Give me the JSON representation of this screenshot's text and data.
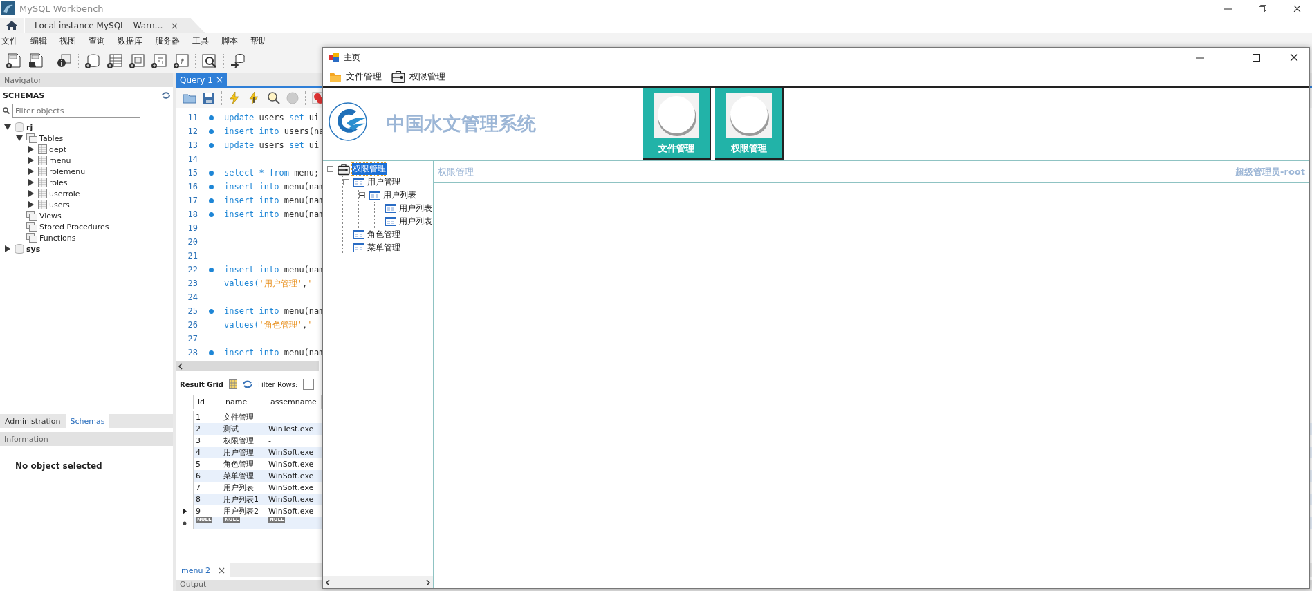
{
  "app": {
    "title": "MySQL Workbench"
  },
  "connection_tabs": [
    {
      "label": "Local instance MySQL - Warn…",
      "selected": true
    }
  ],
  "menu": [
    "文件",
    "编辑",
    "视图",
    "查询",
    "数据库",
    "服务器",
    "工具",
    "脚本",
    "帮助"
  ],
  "navigator": {
    "title": "Navigator",
    "schemas_label": "SCHEMAS",
    "filter_placeholder": "Filter objects",
    "tree": [
      {
        "label": "rj",
        "kind": "schema",
        "expanded": true,
        "children": [
          {
            "label": "Tables",
            "kind": "folder",
            "expanded": true,
            "children": [
              {
                "label": "dept",
                "kind": "table",
                "expanded": false
              },
              {
                "label": "menu",
                "kind": "table",
                "expanded": false
              },
              {
                "label": "rolemenu",
                "kind": "table",
                "expanded": false
              },
              {
                "label": "roles",
                "kind": "table",
                "expanded": false
              },
              {
                "label": "userrole",
                "kind": "table",
                "expanded": false
              },
              {
                "label": "users",
                "kind": "table",
                "expanded": false
              }
            ]
          },
          {
            "label": "Views",
            "kind": "folder"
          },
          {
            "label": "Stored Procedures",
            "kind": "folder"
          },
          {
            "label": "Functions",
            "kind": "folder"
          }
        ]
      },
      {
        "label": "sys",
        "kind": "schema",
        "expanded": false
      }
    ]
  },
  "bottom_tabs": [
    {
      "label": "Administration",
      "selected": false
    },
    {
      "label": "Schemas",
      "selected": true
    }
  ],
  "information": {
    "title": "Information",
    "text": "No object selected"
  },
  "query_tabs": [
    {
      "label": "Query 1",
      "selected": true
    }
  ],
  "editor": {
    "lines": [
      {
        "number": "11",
        "marker": true,
        "code": [
          {
            "t": "update",
            "kind": "keyword"
          },
          {
            "t": " users ",
            "kind": "plain"
          },
          {
            "t": "set",
            "kind": "keyword"
          },
          {
            "t": " ui",
            "kind": "plain"
          }
        ]
      },
      {
        "number": "12",
        "marker": true,
        "code": [
          {
            "t": "insert into",
            "kind": "keyword"
          },
          {
            "t": " users(na",
            "kind": "plain"
          }
        ]
      },
      {
        "number": "13",
        "marker": true,
        "code": [
          {
            "t": "update",
            "kind": "keyword"
          },
          {
            "t": " users ",
            "kind": "plain"
          },
          {
            "t": "set",
            "kind": "keyword"
          },
          {
            "t": " ui",
            "kind": "plain"
          }
        ]
      },
      {
        "number": "14",
        "marker": false
      },
      {
        "number": "15",
        "marker": true,
        "code": [
          {
            "t": "select * from",
            "kind": "keyword"
          },
          {
            "t": " menu;",
            "kind": "plain"
          }
        ]
      },
      {
        "number": "16",
        "marker": true,
        "code": [
          {
            "t": "insert into",
            "kind": "keyword"
          },
          {
            "t": " menu(nam",
            "kind": "plain"
          }
        ]
      },
      {
        "number": "17",
        "marker": true,
        "code": [
          {
            "t": "insert into",
            "kind": "keyword"
          },
          {
            "t": " menu(nam",
            "kind": "plain"
          }
        ]
      },
      {
        "number": "18",
        "marker": true,
        "code": [
          {
            "t": "insert into",
            "kind": "keyword"
          },
          {
            "t": " menu(nam",
            "kind": "plain"
          }
        ]
      },
      {
        "number": "19",
        "marker": false
      },
      {
        "number": "20",
        "marker": false
      },
      {
        "number": "21",
        "marker": false
      },
      {
        "number": "22",
        "marker": true,
        "code": [
          {
            "t": "insert into",
            "kind": "keyword"
          },
          {
            "t": " menu(nam",
            "kind": "plain"
          }
        ]
      },
      {
        "number": "23",
        "marker": false,
        "code": [
          {
            "t": "values(",
            "kind": "keyword"
          },
          {
            "t": "'用户管理'",
            "kind": "string"
          },
          {
            "t": ",",
            "kind": "plain"
          },
          {
            "t": "'",
            "kind": "string"
          }
        ]
      },
      {
        "number": "24",
        "marker": false
      },
      {
        "number": "25",
        "marker": true,
        "code": [
          {
            "t": "insert into",
            "kind": "keyword"
          },
          {
            "t": " menu(nam",
            "kind": "plain"
          }
        ]
      },
      {
        "number": "26",
        "marker": false,
        "code": [
          {
            "t": "values(",
            "kind": "keyword"
          },
          {
            "t": "'角色管理'",
            "kind": "string"
          },
          {
            "t": ",",
            "kind": "plain"
          },
          {
            "t": "'",
            "kind": "string"
          }
        ]
      },
      {
        "number": "27",
        "marker": false
      },
      {
        "number": "28",
        "marker": true,
        "code": [
          {
            "t": "insert into",
            "kind": "keyword"
          },
          {
            "t": " menu(nam",
            "kind": "plain"
          }
        ]
      }
    ]
  },
  "result_grid": {
    "label": "Result Grid",
    "filter_label": "Filter Rows:",
    "columns": [
      "id",
      "name",
      "assemname"
    ],
    "rows": [
      {
        "cells": [
          "1",
          "文件管理",
          "-"
        ],
        "current": false
      },
      {
        "cells": [
          "2",
          "测试",
          "WinTest.exe"
        ],
        "current": false
      },
      {
        "cells": [
          "3",
          "权限管理",
          "-"
        ],
        "current": false
      },
      {
        "cells": [
          "4",
          "用户管理",
          "WinSoft.exe"
        ],
        "current": false
      },
      {
        "cells": [
          "5",
          "角色管理",
          "WinSoft.exe"
        ],
        "current": false
      },
      {
        "cells": [
          "6",
          "菜单管理",
          "WinSoft.exe"
        ],
        "current": false
      },
      {
        "cells": [
          "7",
          "用户列表",
          "WinSoft.exe"
        ],
        "current": false
      },
      {
        "cells": [
          "8",
          "用户列表1",
          "WinSoft.exe"
        ],
        "current": false
      },
      {
        "cells": [
          "9",
          "用户列表2",
          "WinSoft.exe"
        ],
        "current": true
      }
    ],
    "new_row": [
      "NULL",
      "NULL",
      "NULL"
    ]
  },
  "result_tabs": [
    {
      "label": "menu 2",
      "selected": true
    }
  ],
  "output": {
    "title": "Output"
  },
  "form": {
    "title": "主页",
    "menu": [
      {
        "label": "文件管理",
        "kind": "folder"
      },
      {
        "label": "权限管理",
        "kind": "briefcase"
      }
    ],
    "header": {
      "title": "中国水文管理系统",
      "buttons": [
        "文件管理",
        "权限管理"
      ]
    },
    "tree": [
      {
        "label": "权限管理",
        "kind": "briefcase",
        "selected": true,
        "expanded": true,
        "children": [
          {
            "label": "用户管理",
            "kind": "form",
            "selected": false,
            "expanded": true,
            "children": [
              {
                "label": "用户列表",
                "kind": "form",
                "selected": false,
                "expanded": true,
                "children": [
                  {
                    "label": "用户列表",
                    "kind": "form",
                    "selected": false
                  },
                  {
                    "label": "用户列表",
                    "kind": "form",
                    "selected": false
                  }
                ]
              }
            ]
          },
          {
            "label": "角色管理",
            "kind": "form",
            "selected": false
          },
          {
            "label": "菜单管理",
            "kind": "form",
            "selected": false
          }
        ]
      }
    ],
    "content": {
      "title": "权限管理",
      "user": "超级管理员-root"
    }
  }
}
